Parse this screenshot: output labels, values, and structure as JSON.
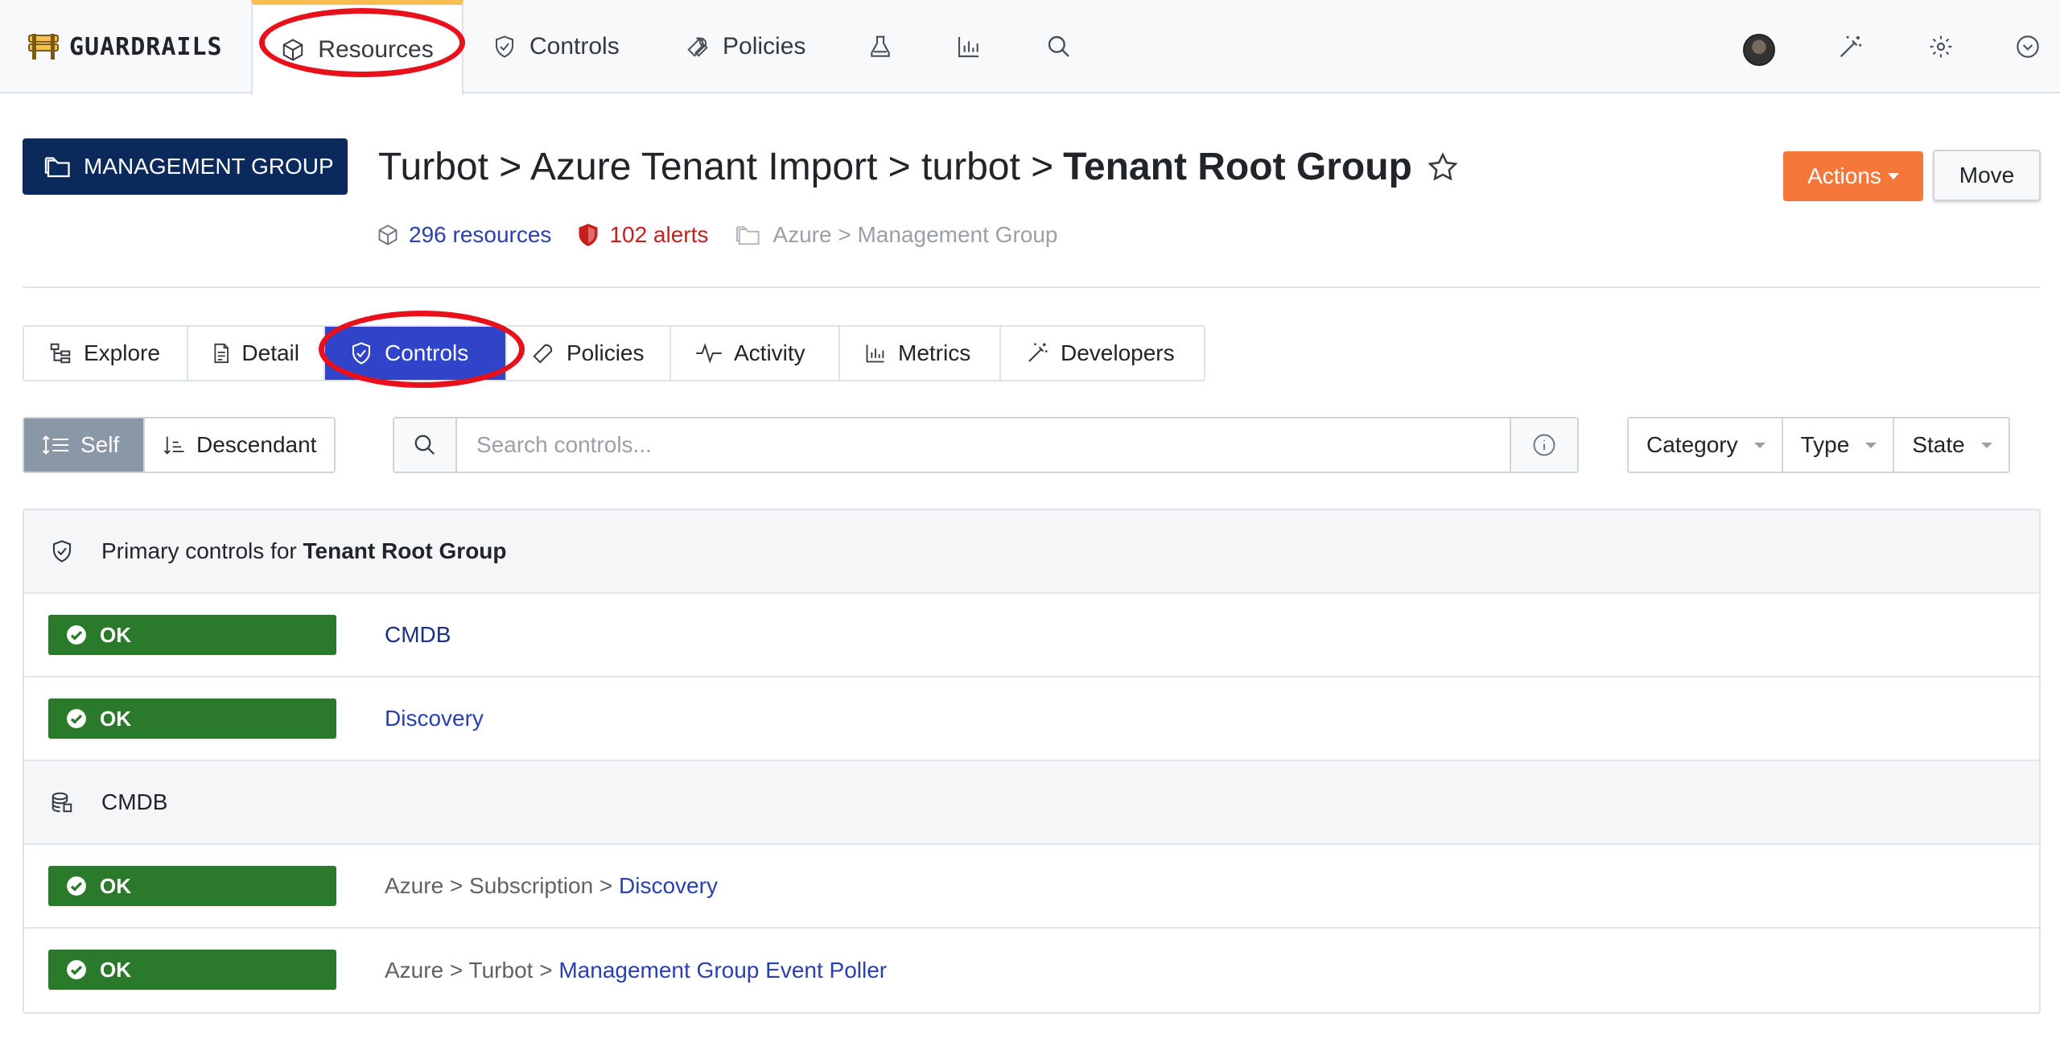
{
  "app": {
    "logo_text": "GUARDRAILS",
    "brand_color": "#f5c04e"
  },
  "topnav": {
    "tabs": [
      {
        "label": "Resources",
        "icon": "cube-icon",
        "active": true
      },
      {
        "label": "Controls",
        "icon": "shield-check-icon",
        "active": false
      },
      {
        "label": "Policies",
        "icon": "wrench-icon",
        "active": false
      }
    ],
    "icon_tabs": [
      "flask-icon",
      "bar-chart-icon",
      "search-icon"
    ],
    "right_icons": [
      "avatar",
      "magic-wand-icon",
      "gear-icon",
      "chevron-circle-icon"
    ]
  },
  "header": {
    "badge_label": "MANAGEMENT GROUP",
    "breadcrumb_path": "Turbot > Azure Tenant Import > turbot >",
    "title": "Tenant Root Group",
    "actions_label": "Actions",
    "move_label": "Move",
    "resources_count": "296 resources",
    "alerts_count": "102 alerts",
    "resource_type": "Azure > Management Group"
  },
  "subtabs": [
    {
      "label": "Explore",
      "icon": "tree-icon",
      "active": false
    },
    {
      "label": "Detail",
      "icon": "document-icon",
      "active": false
    },
    {
      "label": "Controls",
      "icon": "shield-check-icon",
      "active": true
    },
    {
      "label": "Policies",
      "icon": "wrench-icon",
      "active": false
    },
    {
      "label": "Activity",
      "icon": "pulse-icon",
      "active": false
    },
    {
      "label": "Metrics",
      "icon": "bar-chart-icon",
      "active": false
    },
    {
      "label": "Developers",
      "icon": "magic-wand-icon",
      "active": false
    }
  ],
  "filters": {
    "scope": [
      {
        "label": "Self",
        "active": true
      },
      {
        "label": "Descendant",
        "active": false
      }
    ],
    "search_placeholder": "Search controls...",
    "dropdowns": [
      "Category",
      "Type",
      "State"
    ]
  },
  "controls": {
    "primary_prefix": "Primary controls for",
    "primary_resource": "Tenant Root Group",
    "primary_items": [
      {
        "state": "OK",
        "path": "",
        "name": "CMDB"
      },
      {
        "state": "OK",
        "path": "",
        "name": "Discovery"
      }
    ],
    "group_label": "CMDB",
    "group_items": [
      {
        "state": "OK",
        "path": "Azure > Subscription > ",
        "name": "Discovery"
      },
      {
        "state": "OK",
        "path": "Azure > Turbot > ",
        "name": "Management Group Event Poller"
      }
    ],
    "ok_color": "#2b7a2b"
  },
  "colors": {
    "accent": "#2f44c8",
    "actions": "#f6773a",
    "badge": "#0b2a5b",
    "alert": "#c81e1e",
    "annotation": "#e8101a"
  }
}
